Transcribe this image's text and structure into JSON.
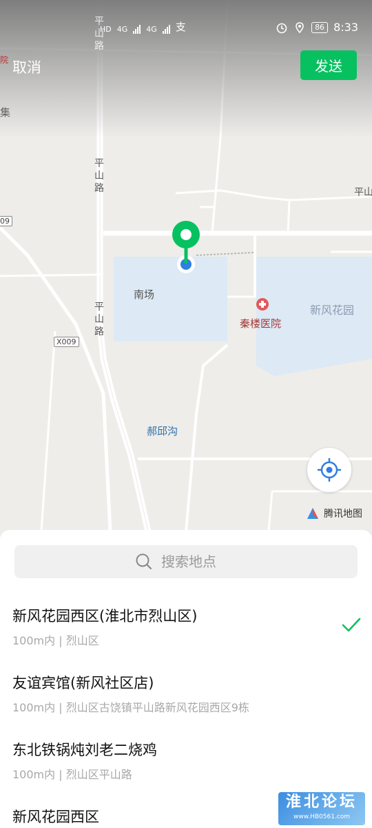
{
  "status_bar": {
    "network_left": "HD",
    "network_right": "HD",
    "signal1": "4G",
    "signal2": "4G",
    "battery": "86",
    "time": "8:33"
  },
  "header": {
    "cancel_label": "取消",
    "send_label": "发送",
    "send_color": "#07c160"
  },
  "map": {
    "road_top": "平山路",
    "road_mid": "平山路",
    "road_low": "平山路",
    "road_right": "平山",
    "road_badge_left": "X009",
    "road_badge_edge": "09",
    "label_edge_top": "院",
    "label_edge_2": "集",
    "poi_nanchang": "南场",
    "poi_hospital": "秦楼医院",
    "poi_garden": "新风花园",
    "poi_gou": "郝邱沟",
    "provider": "腾讯地图",
    "pin_color": "#07c160"
  },
  "search": {
    "placeholder": "搜索地点"
  },
  "places": [
    {
      "name": "新风花园西区(淮北市烈山区)",
      "address": "100m内 | 烈山区",
      "selected": true
    },
    {
      "name": "友谊宾馆(新风社区店)",
      "address": "100m内 | 烈山区古饶镇平山路新风花园西区9栋",
      "selected": false
    },
    {
      "name": "东北铁锅炖刘老二烧鸡",
      "address": "100m内 | 烈山区平山路",
      "selected": false
    },
    {
      "name": "新风花园西区",
      "address": "",
      "selected": false
    }
  ],
  "watermark": {
    "title": "淮北论坛",
    "url": "www.HB0561.com"
  }
}
